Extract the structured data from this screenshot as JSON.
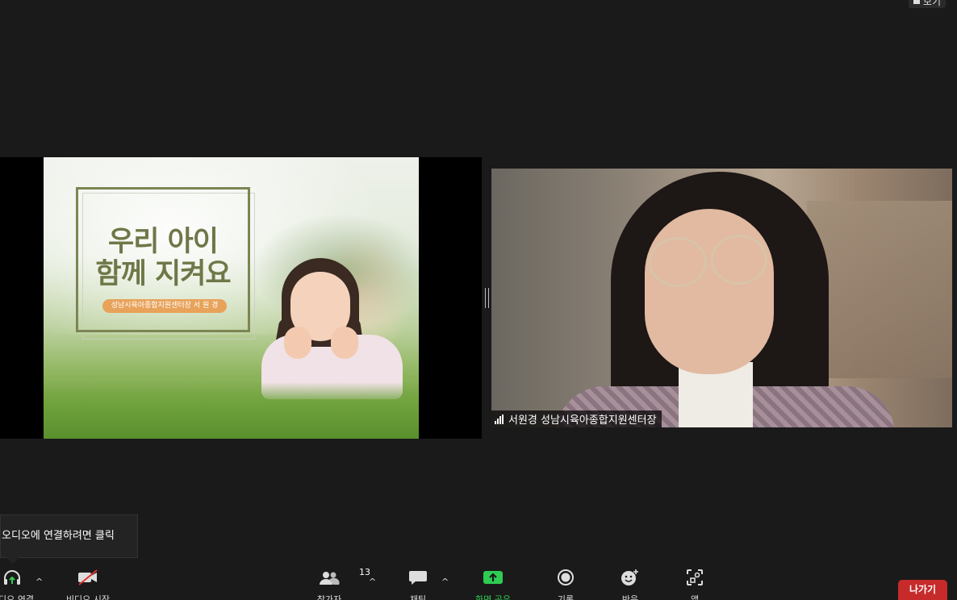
{
  "top_right": {
    "view_label": "보기"
  },
  "slide": {
    "title_line1": "우리 아이",
    "title_line2": "함께 지켜요",
    "subtitle": "성남시육아종합지원센터장 서 원 경"
  },
  "speaker": {
    "name": "서원경 성남시육아종합지원센터장"
  },
  "tooltip": {
    "text": "오디오에 연결하려면 클릭"
  },
  "toolbar": {
    "items": [
      {
        "label": "오디오 연결",
        "icon": "headphones-icon"
      },
      {
        "label": "비디오 시작",
        "icon": "video-off-icon"
      },
      {
        "label": "참가자",
        "icon": "participants-icon",
        "count": "13"
      },
      {
        "label": "채팅",
        "icon": "chat-icon"
      },
      {
        "label": "화면 공유",
        "icon": "share-screen-icon",
        "accent": "#2ecc52"
      },
      {
        "label": "기록",
        "icon": "record-icon"
      },
      {
        "label": "반응",
        "icon": "reactions-icon"
      },
      {
        "label": "앱",
        "icon": "apps-icon"
      }
    ],
    "leave_label": "나가기",
    "leave_color": "#c72a2a"
  }
}
